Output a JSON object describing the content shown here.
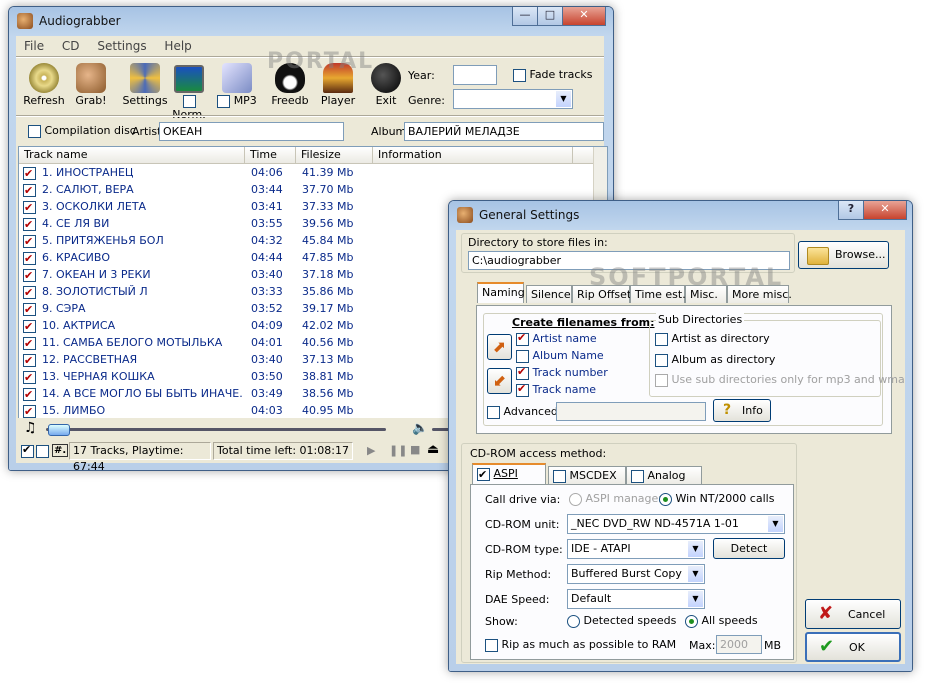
{
  "main_window": {
    "title": "Audiograbber",
    "menu": [
      "File",
      "CD",
      "Settings",
      "Help"
    ],
    "toolbar": {
      "refresh": "Refresh",
      "grab": "Grab!",
      "settings": "Settings",
      "norm": "Norm.",
      "mp3": "MP3",
      "freedb": "Freedb",
      "player": "Player",
      "exit": "Exit"
    },
    "year_label": "Year:",
    "year_value": "",
    "fade_tracks": "Fade tracks",
    "genre_label": "Genre:",
    "genre_value": "",
    "compilation_disc": "Compilation disc",
    "artist_label": "Artist",
    "artist_value": "ОКЕАН",
    "album_label": "Album",
    "album_value": "ВАЛЕРИЙ МЕЛАДЗЕ",
    "columns": [
      "Track name",
      "Time",
      "Filesize",
      "Information"
    ],
    "tracks": [
      {
        "name": "1. ИНОСТРАНЕЦ",
        "time": "04:06",
        "size": "41.39 Mb"
      },
      {
        "name": "2. САЛЮТ, ВЕРА",
        "time": "03:44",
        "size": "37.70 Mb"
      },
      {
        "name": "3. ОСКОЛКИ ЛЕТА",
        "time": "03:41",
        "size": "37.33 Mb"
      },
      {
        "name": "4. СЕ ЛЯ ВИ",
        "time": "03:55",
        "size": "39.56 Mb"
      },
      {
        "name": "5. ПРИТЯЖЕНЬЯ БОЛ",
        "time": "04:32",
        "size": "45.84 Mb"
      },
      {
        "name": "6. КРАСИВО",
        "time": "04:44",
        "size": "47.85 Mb"
      },
      {
        "name": "7. ОКЕАН И 3 РЕКИ",
        "time": "03:40",
        "size": "37.18 Mb"
      },
      {
        "name": "8. ЗОЛОТИСТЫЙ Л",
        "time": "03:33",
        "size": "35.86 Mb"
      },
      {
        "name": "9. СЭРА",
        "time": "03:52",
        "size": "39.17 Mb"
      },
      {
        "name": "10. АКТРИСА",
        "time": "04:09",
        "size": "42.02 Mb"
      },
      {
        "name": "11. САМБА БЕЛОГО МОТЫЛЬКА",
        "time": "04:01",
        "size": "40.56 Mb"
      },
      {
        "name": "12. РАССВЕТНАЯ",
        "time": "03:40",
        "size": "37.13 Mb"
      },
      {
        "name": "13. ЧЕРНАЯ КОШКА",
        "time": "03:50",
        "size": "38.81 Mb"
      },
      {
        "name": "14. А ВСЕ МОГЛО БЫ БЫТЬ ИНАЧЕ.",
        "time": "03:49",
        "size": "38.56 Mb"
      },
      {
        "name": "15. ЛИМБО",
        "time": "04:03",
        "size": "40.95 Mb"
      }
    ],
    "status_select": "#.",
    "status_tracks": "17 Tracks,  Playtime: 67:44",
    "status_time_left": "Total time left: 01:08:17"
  },
  "settings_window": {
    "title": "General Settings",
    "help_btn": "?",
    "dir_label": "Directory to store files in:",
    "dir_value": "C:\\audiograbber",
    "browse": "Browse...",
    "tabs": [
      "Naming",
      "Silence",
      "Rip Offset",
      "Time est.",
      "Misc.",
      "More misc."
    ],
    "create_filenames": "Create filenames from:",
    "filename_items": [
      {
        "label": "Artist name",
        "checked": true
      },
      {
        "label": "Album Name",
        "checked": false
      },
      {
        "label": "Track number",
        "checked": true
      },
      {
        "label": "Track name",
        "checked": true
      }
    ],
    "sub_dirs_title": "Sub Directories",
    "artist_as_dir": "Artist as directory",
    "album_as_dir": "Album as directory",
    "sub_dirs_only": "Use sub directories only for mp3 and wma",
    "advanced": "Advanced",
    "info": "Info",
    "cdrom_title": "CD-ROM access method:",
    "cd_tabs": [
      "ASPI",
      "MSCDEX",
      "Analog"
    ],
    "call_drive_via": "Call drive via:",
    "aspi_manager": "ASPI manager",
    "win_nt": "Win NT/2000 calls",
    "cdrom_unit_label": "CD-ROM unit:",
    "cdrom_unit_value": "_NEC    DVD_RW ND-4571A 1-01",
    "cdrom_type_label": "CD-ROM type:",
    "cdrom_type_value": "IDE  - ATAPI",
    "detect": "Detect",
    "rip_method_label": "Rip Method:",
    "rip_method_value": "Buffered Burst Copy",
    "dae_speed_label": "DAE Speed:",
    "dae_speed_value": "Default",
    "show_label": "Show:",
    "detected_speeds": "Detected speeds",
    "all_speeds": "All speeds",
    "rip_ram": "Rip as much as possible to RAM",
    "max_label": "Max:",
    "max_value": "2000",
    "mb": "MB",
    "cancel": "Cancel",
    "ok": "OK"
  },
  "watermarks": {
    "main": "PORTAL",
    "settings": "SOFTPORTAL"
  }
}
